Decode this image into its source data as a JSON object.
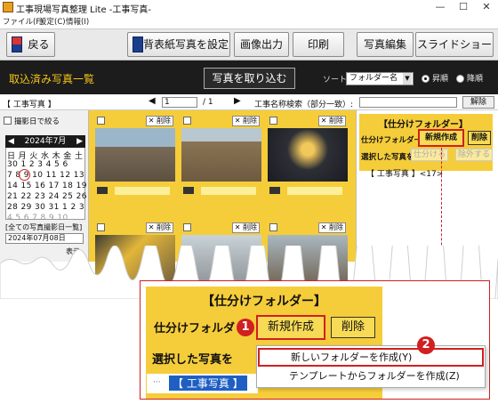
{
  "window": {
    "title": "工事現場写真整理 Lite -工事写真-"
  },
  "menubar": [
    "ファイル(F)",
    "設定(C)",
    "情報(I)"
  ],
  "toolbar": {
    "back": "戻る",
    "set_bg": "背表紙写真を設定",
    "image_out": "画像出力",
    "print": "印刷",
    "photo_edit": "写真編集",
    "slideshow": "スライドショー"
  },
  "header": {
    "title": "取込済み写真一覧",
    "import_button": "写真を取り込む",
    "sort_label": "ソート",
    "sort_value": "フォルダー名",
    "asc": "昇順",
    "desc": "降順"
  },
  "nav": {
    "folder": "【 工事写真 】",
    "page": "1",
    "page_total": "/ 1",
    "search_label": "工事名称検索（部分一致）:",
    "clear": "解除"
  },
  "left": {
    "filter_label": "撮影日で絞る",
    "cal_month": "2024年7月",
    "cal_weekdays": "日 月 火 水 木 金 土",
    "cal_rows": [
      "30 1 2 3 4 5 6",
      "7 8 9 10 11 12 13",
      "14 15 16 17 18 19 20",
      "21 22 23 24 25 26 27",
      "28 29 30 31 1 2 3",
      "4 5 6 7 8 9 10"
    ],
    "all_dates": "[全ての写真撮影日一覧]",
    "date_value": "2024年07月08日",
    "show": "表示"
  },
  "grid": {
    "delete_label": "削除"
  },
  "right": {
    "title": "【仕分けフォルダー】",
    "folder_label": "仕分けフォルダー",
    "new_button": "新規作成",
    "delete_button": "削除",
    "selected_label": "選択した写真を",
    "sort_btn": "仕分ける",
    "remove_btn": "除外する",
    "tree_item": "【 工事写真 】",
    "tree_count": "<17>"
  },
  "callout": {
    "title": "【仕分けフォルダー】",
    "folder_label": "仕分けフォルダ",
    "new_button": "新規作成",
    "delete_button": "削除",
    "selected_label": "選択した写真を",
    "tree_item": "【 工事写真 】",
    "num1": "1",
    "num2": "2",
    "menu_new_folder": "新しいフォルダーを作成(Y)",
    "menu_from_template": "テンプレートからフォルダーを作成(Z)"
  }
}
